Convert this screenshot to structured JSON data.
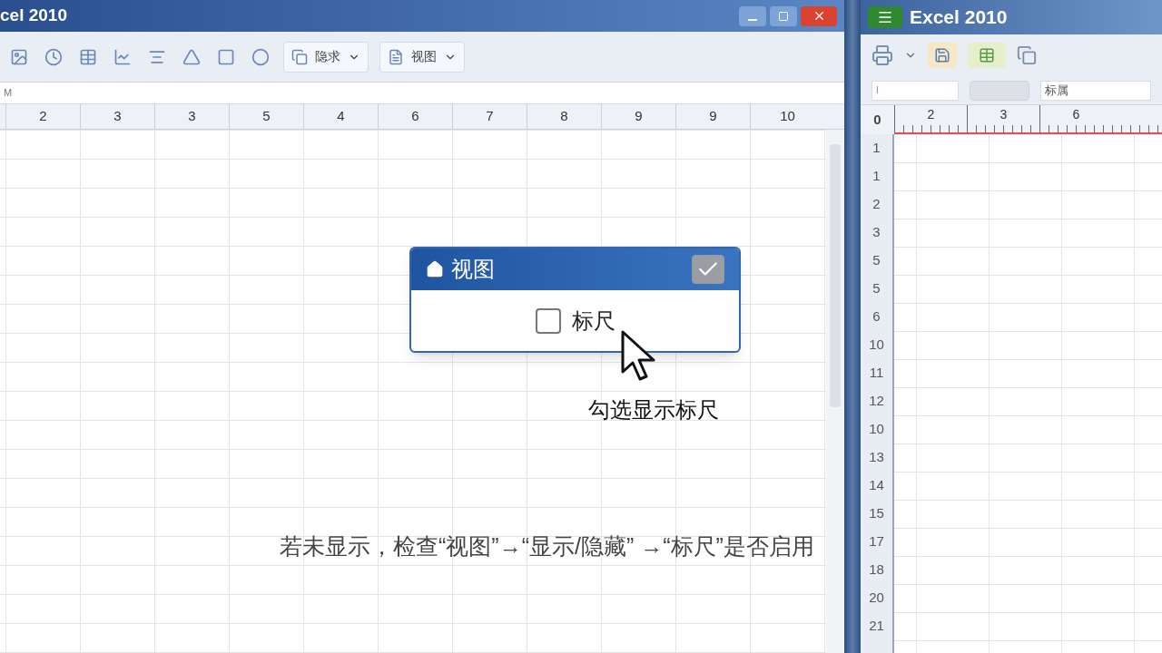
{
  "left_window": {
    "title": "cel 2010",
    "toolbar": {
      "dropdowns": [
        {
          "label": "隐求"
        },
        {
          "label": "视图"
        }
      ]
    },
    "formula_bar": {
      "value": "M"
    },
    "column_ruler": [
      "2",
      "3",
      "3",
      "5",
      "4",
      "6",
      "7",
      "8",
      "9",
      "9",
      "10"
    ]
  },
  "right_window": {
    "title": "Excel 2010",
    "fields": {
      "name_box": "I",
      "field_2": "标属"
    },
    "ruler": {
      "origin": "0",
      "ticks": [
        "2",
        "3",
        "6"
      ]
    },
    "row_headers": [
      "1",
      "1",
      "2",
      "3",
      "5",
      "5",
      "6",
      "10",
      "11",
      "12",
      "10",
      "13",
      "14",
      "15",
      "17",
      "18",
      "20",
      "21"
    ]
  },
  "dialog": {
    "title": "视图",
    "confirmed": true,
    "options": [
      {
        "label": "标尺",
        "checked": false
      }
    ]
  },
  "hint": "勾选显示标尺",
  "caption": "若未显示，检查“视图”→“显示/隐藏” →“标尺”是否启用"
}
